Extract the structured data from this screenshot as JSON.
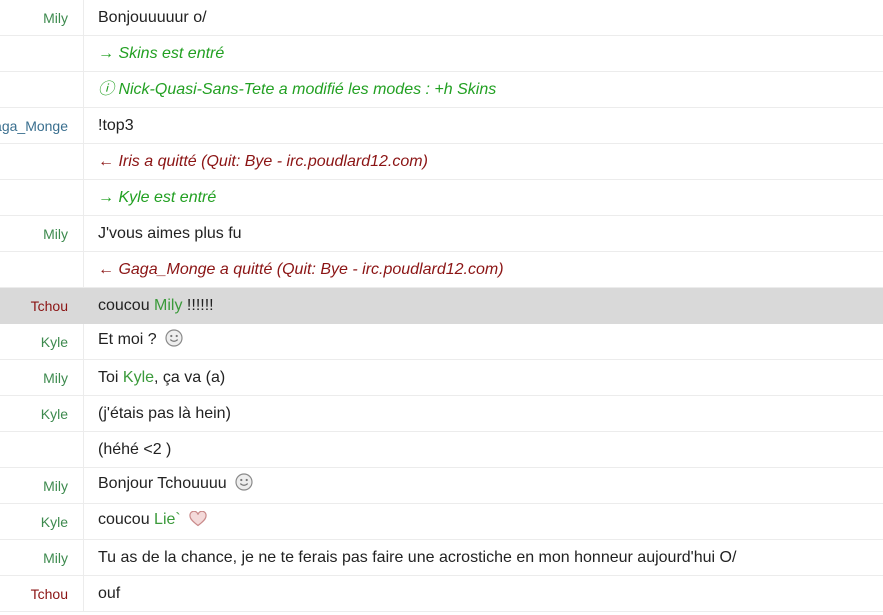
{
  "nick_colors": {
    "Mily": "#3d8a4e",
    "Gaga_Monge": "#3a6f8f",
    "Tchou": "#8b1414",
    "Kyle": "#3d8a4e"
  },
  "rows": [
    {
      "nick": "Mily",
      "type": "msg",
      "parts": [
        {
          "t": "Bonjouuuuur o/"
        }
      ]
    },
    {
      "nick": "",
      "type": "join",
      "parts": [
        {
          "t": "→ Skins est entré"
        }
      ]
    },
    {
      "nick": "",
      "type": "mode",
      "parts": [
        {
          "t": "ⓘ Nick-Quasi-Sans-Tete a modifié les modes : +h Skins"
        }
      ]
    },
    {
      "nick": "Gaga_Monge",
      "type": "msg",
      "parts": [
        {
          "t": "!top3"
        }
      ]
    },
    {
      "nick": "",
      "type": "part",
      "parts": [
        {
          "t": "← Iris a quitté (Quit: Bye - irc.poudlard12.com)"
        }
      ]
    },
    {
      "nick": "",
      "type": "join",
      "parts": [
        {
          "t": "→ Kyle est entré"
        }
      ]
    },
    {
      "nick": "Mily",
      "type": "msg",
      "parts": [
        {
          "t": "J'vous aimes plus fu"
        }
      ]
    },
    {
      "nick": "",
      "type": "part",
      "parts": [
        {
          "t": "← Gaga_Monge a quitté (Quit: Bye - irc.poudlard12.com)"
        }
      ]
    },
    {
      "nick": "Tchou",
      "type": "msg",
      "highlight": true,
      "parts": [
        {
          "t": "coucou "
        },
        {
          "t": "Mily",
          "mention": true
        },
        {
          "t": " !!!!!!"
        }
      ]
    },
    {
      "nick": "Kyle",
      "type": "msg",
      "parts": [
        {
          "t": "Et moi ? "
        },
        {
          "icon": "smiley-icon"
        }
      ]
    },
    {
      "nick": "Mily",
      "type": "msg",
      "parts": [
        {
          "t": "Toi "
        },
        {
          "t": "Kyle",
          "mention": true
        },
        {
          "t": ", ça va (a)"
        }
      ]
    },
    {
      "nick": "Kyle",
      "type": "msg",
      "parts": [
        {
          "t": "(j'étais pas là hein)"
        }
      ]
    },
    {
      "nick": "",
      "type": "msg",
      "parts": [
        {
          "t": "(héhé <2 )"
        }
      ]
    },
    {
      "nick": "Mily",
      "type": "msg",
      "parts": [
        {
          "t": "Bonjour Tchouuuu "
        },
        {
          "icon": "smiley-icon"
        }
      ]
    },
    {
      "nick": "Kyle",
      "type": "msg",
      "parts": [
        {
          "t": "coucou "
        },
        {
          "t": "Lie`",
          "mention": true
        },
        {
          "t": " "
        },
        {
          "icon": "heart-icon"
        }
      ]
    },
    {
      "nick": "Mily",
      "type": "msg",
      "parts": [
        {
          "t": "Tu as de la chance, je ne te ferais pas faire une acrostiche en mon honneur aujourd'hui O/"
        }
      ]
    },
    {
      "nick": "Tchou",
      "type": "msg",
      "parts": [
        {
          "t": "ouf"
        }
      ]
    }
  ]
}
